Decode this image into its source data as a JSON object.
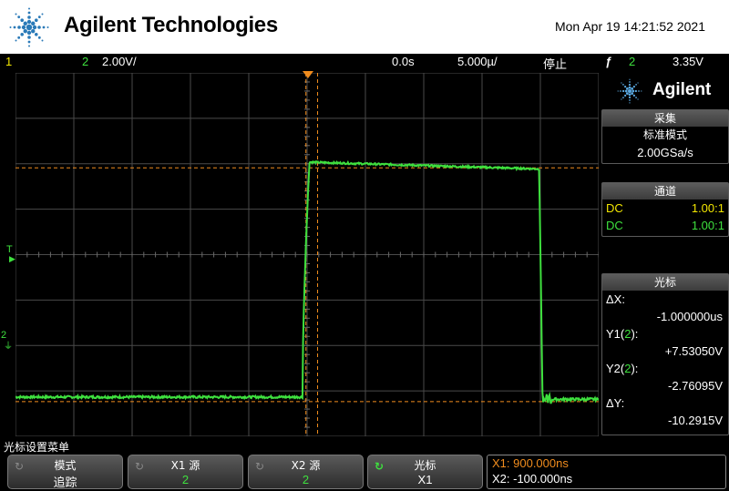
{
  "header": {
    "brand": "Agilent Technologies",
    "datetime": "Mon Apr 19 14:21:52 2021"
  },
  "status": {
    "ch1_label": "1",
    "ch2_label": "2",
    "ch2_scale": "2.00V/",
    "time_delay": "0.0s",
    "time_scale": "5.000µ/",
    "run_state": "停止",
    "trigger_symbol": "ƒ",
    "trigger_channel": "2",
    "trigger_level": "3.35V"
  },
  "markers": {
    "trigger": "T",
    "ch2": "2"
  },
  "panel": {
    "brand": "Agilent",
    "acquire": {
      "header": "采集",
      "mode": "标准模式",
      "rate": "2.00GSa/s"
    },
    "channels": {
      "header": "通道",
      "rows": [
        {
          "coupling": "DC",
          "probe": "1.00:1",
          "color": "#f2e600"
        },
        {
          "coupling": "DC",
          "probe": "1.00:1",
          "color": "#3ee03e"
        }
      ]
    },
    "cursors": {
      "header": "光标",
      "dx_label": "ΔX:",
      "dx_value": "-1.000000us",
      "y1_label_pre": "Y1(",
      "y1_label_ch": "2",
      "y1_label_post": "):",
      "y1_value": "+7.53050V",
      "y2_label_pre": "Y2(",
      "y2_label_ch": "2",
      "y2_label_post": "):",
      "y2_value": "-2.76095V",
      "dy_label": "ΔY:",
      "dy_value": "-10.2915V"
    }
  },
  "menu": {
    "title": "光标设置菜单",
    "softkeys": [
      {
        "label": "模式",
        "value": "追踪",
        "active": false
      },
      {
        "label": "X1 源",
        "value": "2",
        "active": false
      },
      {
        "label": "X2 源",
        "value": "2",
        "active": false
      },
      {
        "label": "光标",
        "value": "X1",
        "active": true
      }
    ],
    "readout": {
      "x1": "X1: 900.000ns",
      "x2": "X2: -100.000ns"
    }
  },
  "colors": {
    "trace": "#3ee03e",
    "cursor": "#f08c1e",
    "grid": "#4a4a4a",
    "ch1": "#f2e600"
  },
  "trace": {
    "volts_per_div": 2,
    "us_per_div": 5,
    "baseline_v": -2.76,
    "high_v": 7.53,
    "rise_start_us": -0.4,
    "rise_end_us": 0.2,
    "fall_us": 19.9,
    "fall_end_us": 20.2
  }
}
